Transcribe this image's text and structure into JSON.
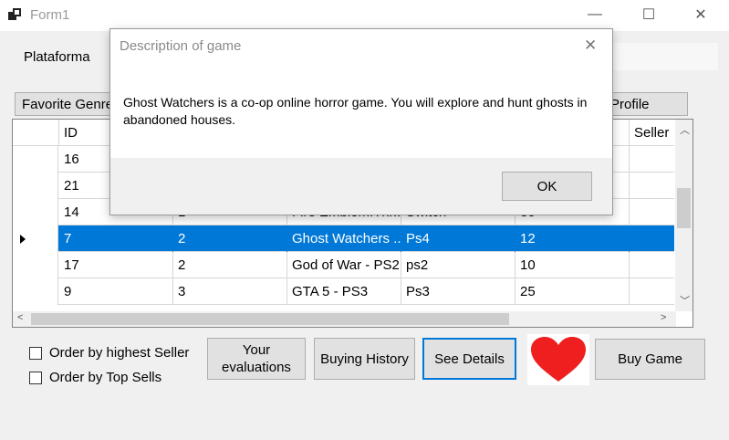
{
  "window": {
    "title": "Form1",
    "minimize": "—",
    "maximize": "☐",
    "close": "✕"
  },
  "form": {
    "plataforma_label": "Plataforma",
    "favorite_genre_button": "Favorite Genre",
    "profile_button": "Profile",
    "grid": {
      "columns": [
        "ID",
        "",
        "",
        "",
        "",
        "Seller"
      ],
      "rows": [
        {
          "id": "16",
          "c2": "",
          "c3": "",
          "c4": "",
          "c5": ""
        },
        {
          "id": "21",
          "c2": "",
          "c3": "",
          "c4": "",
          "c5": ""
        },
        {
          "id": "14",
          "c2": "1",
          "c3": "Fire Emblem:Thr...",
          "c4": "Switch",
          "c5": "30"
        },
        {
          "id": "7",
          "c2": "2",
          "c3": "Ghost Watchers ...",
          "c4": "Ps4",
          "c5": "12"
        },
        {
          "id": "17",
          "c2": "2",
          "c3": "God of War - PS2",
          "c4": "ps2",
          "c5": "10"
        },
        {
          "id": "9",
          "c2": "3",
          "c3": "GTA 5 - PS3",
          "c4": "Ps3",
          "c5": "25"
        }
      ],
      "selected_row_index": 3
    },
    "checkboxes": [
      {
        "label": "Order by highest Seller",
        "checked": false
      },
      {
        "label": "Order by Top Sells",
        "checked": false
      }
    ],
    "buttons": {
      "evaluations": "Your evaluations",
      "buying_history": "Buying History",
      "see_details": "See Details",
      "buy_game": "Buy  Game"
    },
    "heart_icon": "heart-icon"
  },
  "dialog": {
    "title": "Description of game",
    "message": "Ghost Watchers is a co-op online horror game. You will explore and hunt ghosts in abandoned houses.",
    "ok_button": "OK"
  },
  "colors": {
    "selection": "#0078d7",
    "heart": "#f01f1f",
    "focus_border": "#0078d7"
  }
}
